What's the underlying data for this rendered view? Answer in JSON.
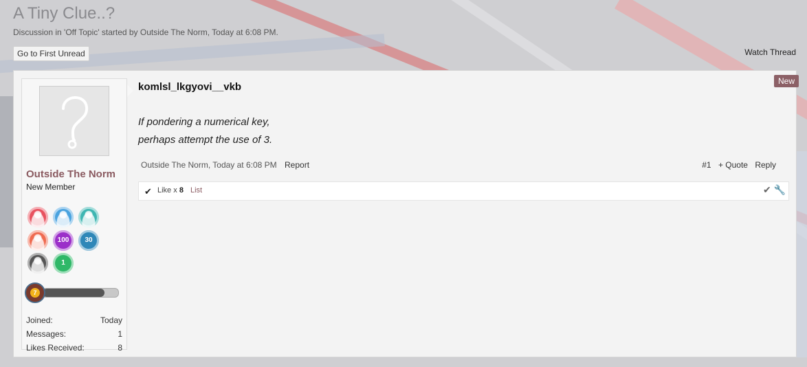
{
  "thread": {
    "title": "A Tiny Clue..?",
    "subtitle": "Discussion in 'Off Topic' started by Outside The Norm, Today at 6:08 PM.",
    "first_unread_label": "Go to First Unread",
    "watch_label": "Watch Thread"
  },
  "post": {
    "title": "komlsl_lkgyovi__vkb",
    "new_label": "New",
    "message_lines": [
      "If pondering a numerical key,",
      "perhaps attempt the use of 3."
    ],
    "author": "Outside The Norm",
    "time": "Today at 6:08 PM",
    "report_label": "Report",
    "number": "#1",
    "quote_label": "+ Quote",
    "reply_label": "Reply",
    "likes": {
      "label": "Like x",
      "count": "8",
      "list_label": "List"
    }
  },
  "user": {
    "name": "Outside The Norm",
    "title": "New Member",
    "level": "7",
    "level_progress": 0.82,
    "stats": [
      {
        "label": "Joined:",
        "value": "Today"
      },
      {
        "label": "Messages:",
        "value": "1"
      },
      {
        "label": "Likes Received:",
        "value": "8"
      }
    ],
    "trophies": [
      {
        "icon": "trophy-person-red-icon",
        "color": "#e8525f"
      },
      {
        "icon": "trophy-person-blue-icon",
        "color": "#4aa3df"
      },
      {
        "icon": "trophy-person-teal-icon",
        "color": "#3fb6b2"
      },
      {
        "icon": "trophy-person-orange-icon",
        "color": "#ef6b51"
      },
      {
        "icon": "trophy-100-icon",
        "color": "#9b2fc9",
        "label": "100"
      },
      {
        "icon": "trophy-30-icon",
        "color": "#2f87b8",
        "label": "30"
      },
      {
        "icon": "trophy-person-gray-icon",
        "color": "#555555"
      },
      {
        "icon": "trophy-1-icon",
        "color": "#2fb868",
        "label": "1"
      }
    ]
  }
}
